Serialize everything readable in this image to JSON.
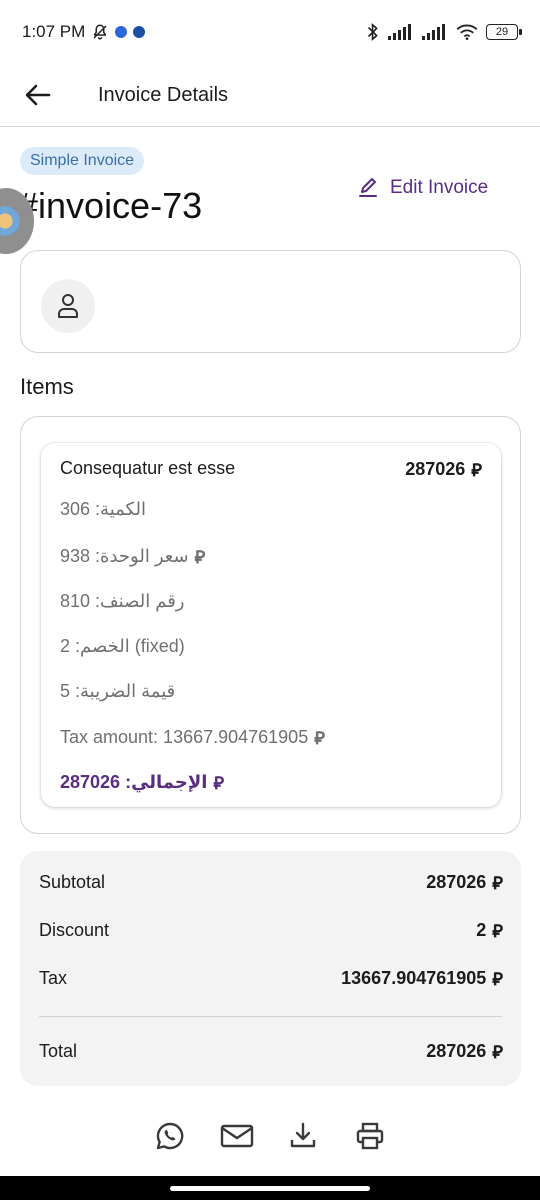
{
  "status_bar": {
    "time": "1:07 PM",
    "battery": "29"
  },
  "app_bar": {
    "title": "Invoice Details"
  },
  "invoice": {
    "type_chip": "Simple Invoice",
    "number": "#invoice-73",
    "edit_label": "Edit Invoice"
  },
  "items_section": {
    "title": "Items",
    "items": [
      {
        "name": "Consequatur est esse",
        "price": "287026",
        "quantity": "الكمية: 306",
        "unit_price": "سعر الوحدة: 938",
        "item_number": "رقم الصنف: 810",
        "discount": "الخصم: 2 (fixed)",
        "tax_rate": "قيمة الضريبة: 5",
        "tax_amount": "Tax amount: 13667.904761905",
        "total": "الإجمالي: 287026"
      }
    ]
  },
  "summary": {
    "subtotal_label": "Subtotal",
    "subtotal_value": "287026",
    "discount_label": "Discount",
    "discount_value": "2",
    "tax_label": "Tax",
    "tax_value": "13667.904761905",
    "total_label": "Total",
    "total_value": "287026"
  },
  "currency_symbol": "⃁",
  "colors": {
    "accent": "#5a2d82",
    "chip_bg": "#dcebf9",
    "chip_text": "#3a6ea8",
    "summary_bg": "#f3f3f3"
  },
  "icons": [
    "back-arrow-icon",
    "pencil-icon",
    "user-icon",
    "whatsapp-icon",
    "email-icon",
    "download-icon",
    "print-icon"
  ]
}
